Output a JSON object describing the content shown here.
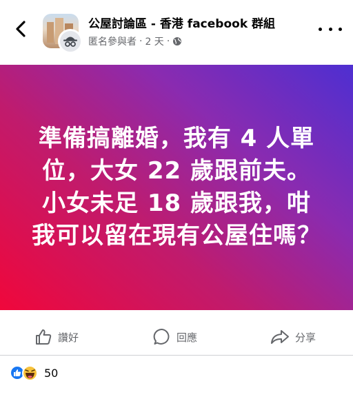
{
  "header": {
    "group_title": "公屋討論區 - 香港 facebook 群組",
    "author": "匿名參與者",
    "separator": "·",
    "time_ago": "2 天",
    "separator2": "·"
  },
  "post": {
    "text": "準備搞離婚，我有 4 人單位，大女 22 歲跟前夫。小女未足 18 歲跟我，咁我可以留在現有公屋住嗎？",
    "gradient_colors": [
      "#f0073b",
      "#8a2bb0",
      "#4e2fd1"
    ]
  },
  "actions": {
    "like_label": "讚好",
    "comment_label": "回應",
    "share_label": "分享"
  },
  "reactions": {
    "count": "50",
    "types": [
      "like",
      "haha"
    ]
  },
  "icons": {
    "back": "chevron-left-icon",
    "more": "more-dots-icon",
    "globe": "globe-icon",
    "like": "thumbs-up-icon",
    "comment": "comment-bubble-icon",
    "share": "share-arrow-icon"
  }
}
